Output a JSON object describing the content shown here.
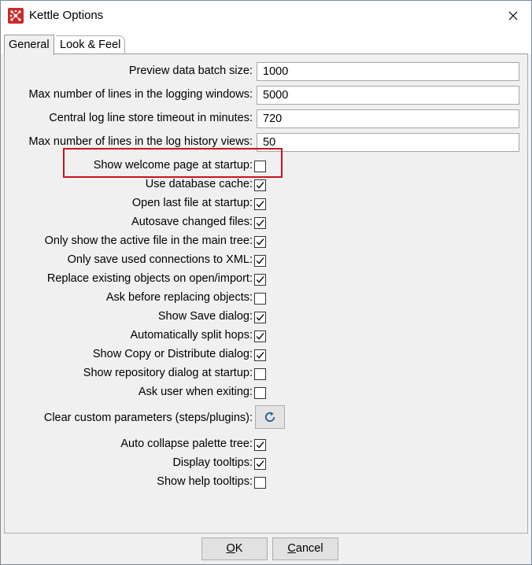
{
  "window": {
    "title": "Kettle Options",
    "app_icon": "kettle-spoon-icon",
    "close_icon": "close-icon"
  },
  "tabs": [
    {
      "label": "General",
      "active": true
    },
    {
      "label": "Look & Feel",
      "active": false
    }
  ],
  "text_fields": [
    {
      "label": "Preview data batch size:",
      "value": "1000"
    },
    {
      "label": "Max number of lines in the logging windows:",
      "value": "5000"
    },
    {
      "label": "Central log line store timeout in minutes:",
      "value": "720"
    },
    {
      "label": "Max number of lines in the log history views:",
      "value": "50"
    }
  ],
  "checkboxes_a": [
    {
      "label": "Show welcome page at startup:",
      "checked": false,
      "highlighted": true
    },
    {
      "label": "Use database cache:",
      "checked": true
    },
    {
      "label": "Open last file at startup:",
      "checked": true
    },
    {
      "label": "Autosave changed files:",
      "checked": true
    },
    {
      "label": "Only show the active file in the main tree:",
      "checked": true
    },
    {
      "label": "Only save used connections to XML:",
      "checked": true
    },
    {
      "label": "Replace existing objects on open/import:",
      "checked": true
    },
    {
      "label": "Ask before replacing objects:",
      "checked": false
    },
    {
      "label": "Show Save dialog:",
      "checked": true
    },
    {
      "label": "Automatically split hops:",
      "checked": true
    },
    {
      "label": "Show Copy or Distribute dialog:",
      "checked": true
    },
    {
      "label": "Show repository dialog at startup:",
      "checked": false
    },
    {
      "label": "Ask user when exiting:",
      "checked": false
    }
  ],
  "clear_params": {
    "label": "Clear custom parameters (steps/plugins):",
    "icon": "refresh-icon"
  },
  "checkboxes_b": [
    {
      "label": "Auto collapse palette tree:",
      "checked": true
    },
    {
      "label": "Display tooltips:",
      "checked": true
    },
    {
      "label": "Show help tooltips:",
      "checked": false
    }
  ],
  "buttons": {
    "ok": {
      "mnemonic": "O",
      "rest": "K"
    },
    "cancel": {
      "mnemonic": "C",
      "rest": "ancel"
    }
  },
  "colors": {
    "highlight": "#c8141e",
    "app_icon": "#c92b2b",
    "refresh_icon": "#1f5d99"
  }
}
